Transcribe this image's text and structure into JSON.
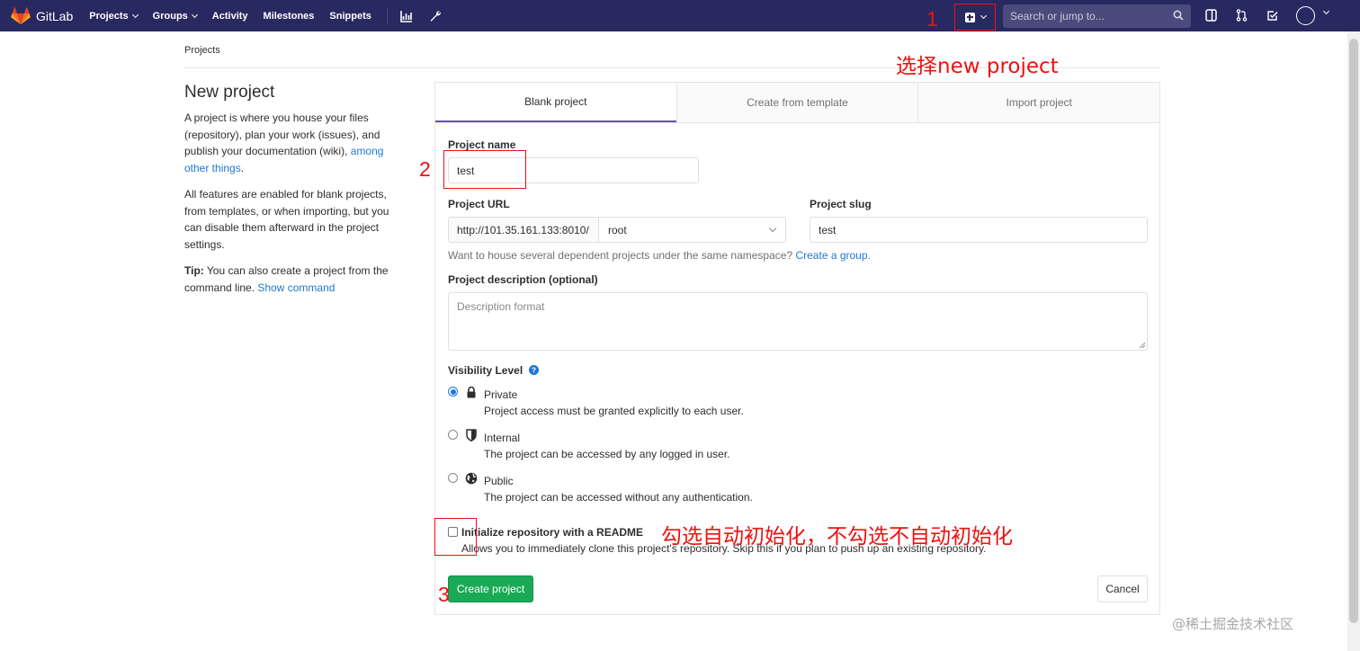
{
  "navbar": {
    "brand": "GitLab",
    "links": [
      {
        "label": "Projects",
        "has_caret": true
      },
      {
        "label": "Groups",
        "has_caret": true
      },
      {
        "label": "Activity",
        "has_caret": false
      },
      {
        "label": "Milestones",
        "has_caret": false
      },
      {
        "label": "Snippets",
        "has_caret": false
      }
    ],
    "search_placeholder": "Search or jump to...",
    "accent": "#292961"
  },
  "breadcrumb": "Projects",
  "sidebar": {
    "title": "New project",
    "intro_before_link": "A project is where you house your files (repository), plan your work (issues), and publish your documentation (wiki), ",
    "intro_link": "among other things",
    "intro_after_link": ".",
    "features_text": "All features are enabled for blank projects, from templates, or when importing, but you can disable them afterward in the project settings.",
    "tip_label": "Tip:",
    "tip_text": " You can also create a project from the command line. ",
    "tip_link": "Show command"
  },
  "tabs": [
    {
      "label": "Blank project",
      "active": true
    },
    {
      "label": "Create from template",
      "active": false
    },
    {
      "label": "Import project",
      "active": false
    }
  ],
  "form": {
    "project_name_label": "Project name",
    "project_name_value": "test",
    "project_url_label": "Project URL",
    "url_prefix": "http://101.35.161.133:8010/",
    "namespace_value": "root",
    "project_slug_label": "Project slug",
    "project_slug_value": "test",
    "namespace_help": "Want to house several dependent projects under the same namespace? ",
    "namespace_help_link": "Create a group.",
    "description_label": "Project description (optional)",
    "description_placeholder": "Description format",
    "visibility_label": "Visibility Level",
    "visibility_options": [
      {
        "title": "Private",
        "desc": "Project access must be granted explicitly to each user.",
        "checked": true,
        "icon": "lock-icon"
      },
      {
        "title": "Internal",
        "desc": "The project can be accessed by any logged in user.",
        "checked": false,
        "icon": "shield-icon"
      },
      {
        "title": "Public",
        "desc": "The project can be accessed without any authentication.",
        "checked": false,
        "icon": "globe-icon"
      }
    ],
    "readme_label": "Initialize repository with a README",
    "readme_help": "Allows you to immediately clone this project's repository. Skip this if you plan to push up an existing repository.",
    "create_button": "Create project",
    "cancel_button": "Cancel",
    "create_color": "#1aaa55"
  },
  "annotations": {
    "step1": "1",
    "step1_text": "选择new project",
    "step2": "2",
    "step3": "3",
    "step3_text": "勾选自动初始化，不勾选不自动初始化",
    "color": "#ee1111"
  },
  "watermark": "@稀土掘金技术社区"
}
